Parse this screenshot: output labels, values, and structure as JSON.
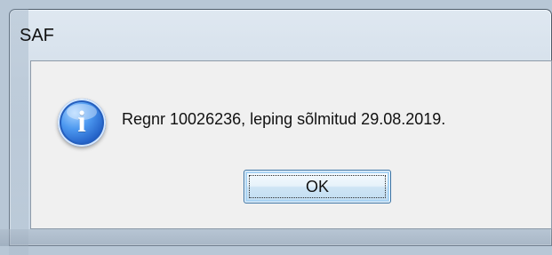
{
  "dialog": {
    "title": "SAF",
    "message": "Regnr 10026236, leping sõlmitud 29.08.2019.",
    "icon": "information-icon",
    "ok_label": "OK"
  }
}
